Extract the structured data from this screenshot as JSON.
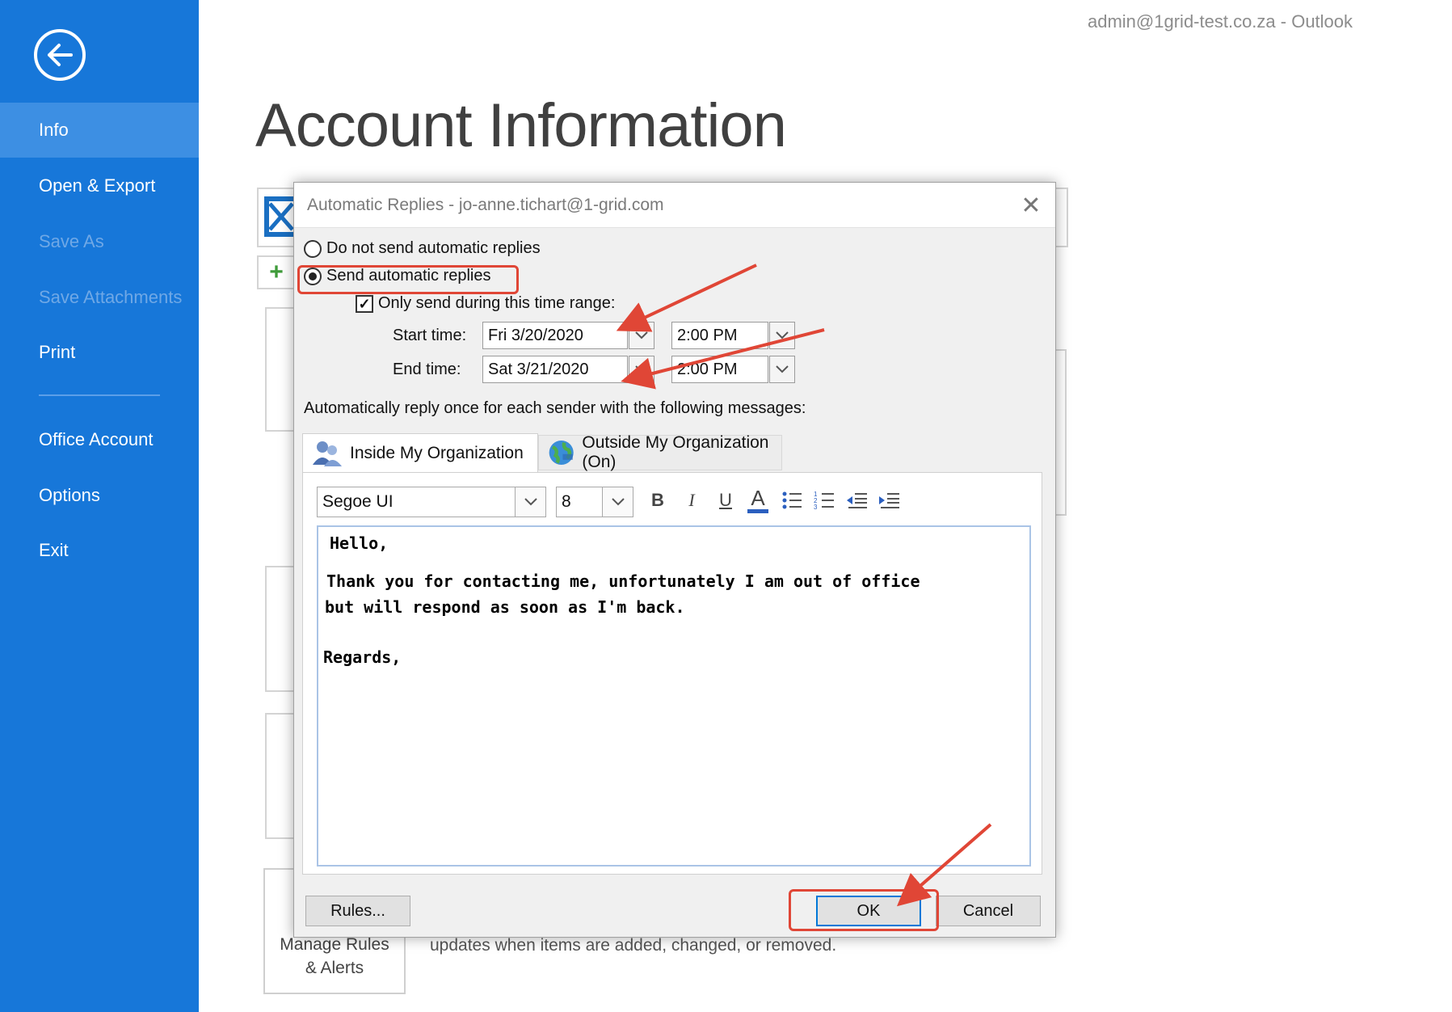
{
  "window": {
    "title": "admin@1grid-test.co.za - Outlook"
  },
  "sidebar": {
    "back_icon": "back-arrow-circle-icon",
    "items": [
      {
        "label": "Info",
        "state": "active"
      },
      {
        "label": "Open & Export",
        "state": "normal"
      },
      {
        "label": "Save As",
        "state": "disabled"
      },
      {
        "label": "Save Attachments",
        "state": "disabled"
      },
      {
        "label": "Print",
        "state": "normal"
      },
      {
        "label": "Office Account",
        "state": "normal"
      },
      {
        "label": "Options",
        "state": "normal"
      },
      {
        "label": "Exit",
        "state": "normal"
      }
    ],
    "color": "#1777d9"
  },
  "main": {
    "title": "Account Information",
    "manage_rules_label": "Manage Rules\n& Alerts",
    "manage_rules_desc": "updates when items are added, changed, or removed."
  },
  "dialog": {
    "title": "Automatic Replies - jo-anne.tichart@1-grid.com",
    "options": {
      "no_send": "Do not send automatic replies",
      "send": "Send automatic replies",
      "selected": "send"
    },
    "time_range": {
      "label": "Only send during this time range:",
      "checked": true,
      "start_label": "Start time:",
      "start_date": "Fri 3/20/2020",
      "start_time": "2:00 PM",
      "end_label": "End time:",
      "end_date": "Sat 3/21/2020",
      "end_time": "2:00 PM"
    },
    "auto_reply_label": "Automatically reply once for each sender with the following messages:",
    "tabs": [
      {
        "label": "Inside My Organization",
        "active": true
      },
      {
        "label": "Outside My Organization (On)",
        "active": false
      }
    ],
    "format": {
      "font": "Segoe UI",
      "size": "8",
      "bold": "B",
      "italic": "I",
      "underline": "U",
      "font_color": "A"
    },
    "message": {
      "line1": "Hello,",
      "line2": "Thank you for contacting me, unfortunately I am out of office",
      "line3": "but will respond as soon as I'm back.",
      "line4": "Regards,"
    },
    "buttons": {
      "rules": "Rules...",
      "ok": "OK",
      "cancel": "Cancel"
    }
  },
  "annotation_color": "#e04636"
}
